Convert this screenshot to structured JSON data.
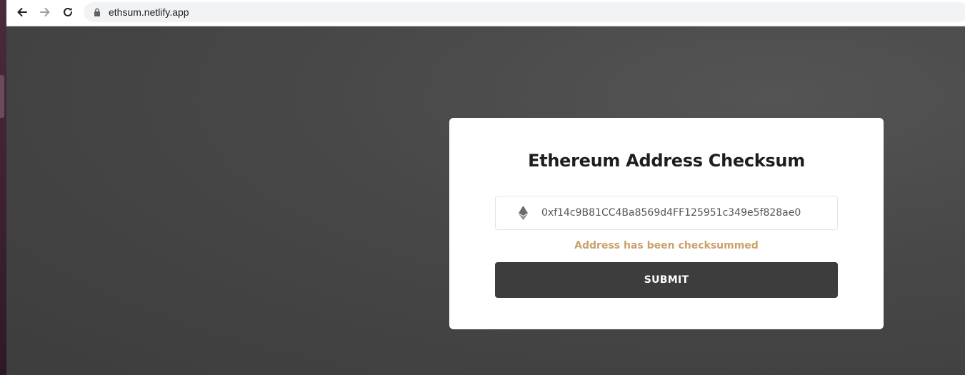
{
  "browser": {
    "url": "ethsum.netlify.app",
    "icons": {
      "back": "arrow-left-icon",
      "forward": "arrow-right-icon",
      "reload": "reload-icon",
      "lock": "lock-icon"
    }
  },
  "card": {
    "title": "Ethereum Address Checksum",
    "input_value": "0xf14c9B81CC4Ba8569d4FF125951c349e5f828ae0",
    "status_message": "Address has been checksummed",
    "submit_label": "SUBMIT",
    "icon": "ethereum-icon"
  },
  "colors": {
    "background": "#474747",
    "card": "#ffffff",
    "button": "#3d3d3d",
    "status": "#c9a16a"
  }
}
